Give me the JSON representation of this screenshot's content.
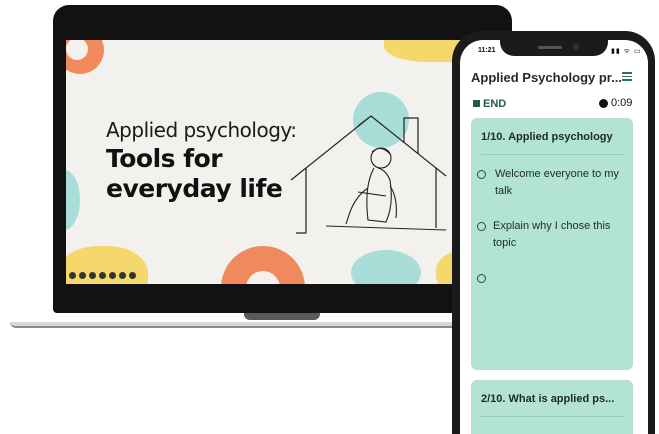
{
  "slide": {
    "title_line1": "Applied psychology:",
    "title_line2": "Tools for everyday life",
    "toolbar_icons": [
      "back-icon",
      "pen-icon",
      "zoom-icon",
      "grid-icon",
      "screen-icon",
      "view-icon",
      "forward-icon"
    ]
  },
  "phone": {
    "status_time": "11:21",
    "status_icons": "▮▮ ᯤ ▭",
    "app_title": "Applied Psychology pr...",
    "end_label": "END",
    "timer": "0:09",
    "cards": [
      {
        "title": "1/10. Applied psychology",
        "bullets": [
          "Welcome everyone to my talk",
          "Explain why I chose this topic",
          ""
        ]
      },
      {
        "title": "2/10. What is applied ps..."
      }
    ]
  },
  "colors": {
    "card_bg": "#b3e3d3",
    "accent": "#1f5a52",
    "blob_teal": "#a8ddd8",
    "blob_orange": "#f08a5d",
    "blob_yellow": "#f5d86b"
  }
}
